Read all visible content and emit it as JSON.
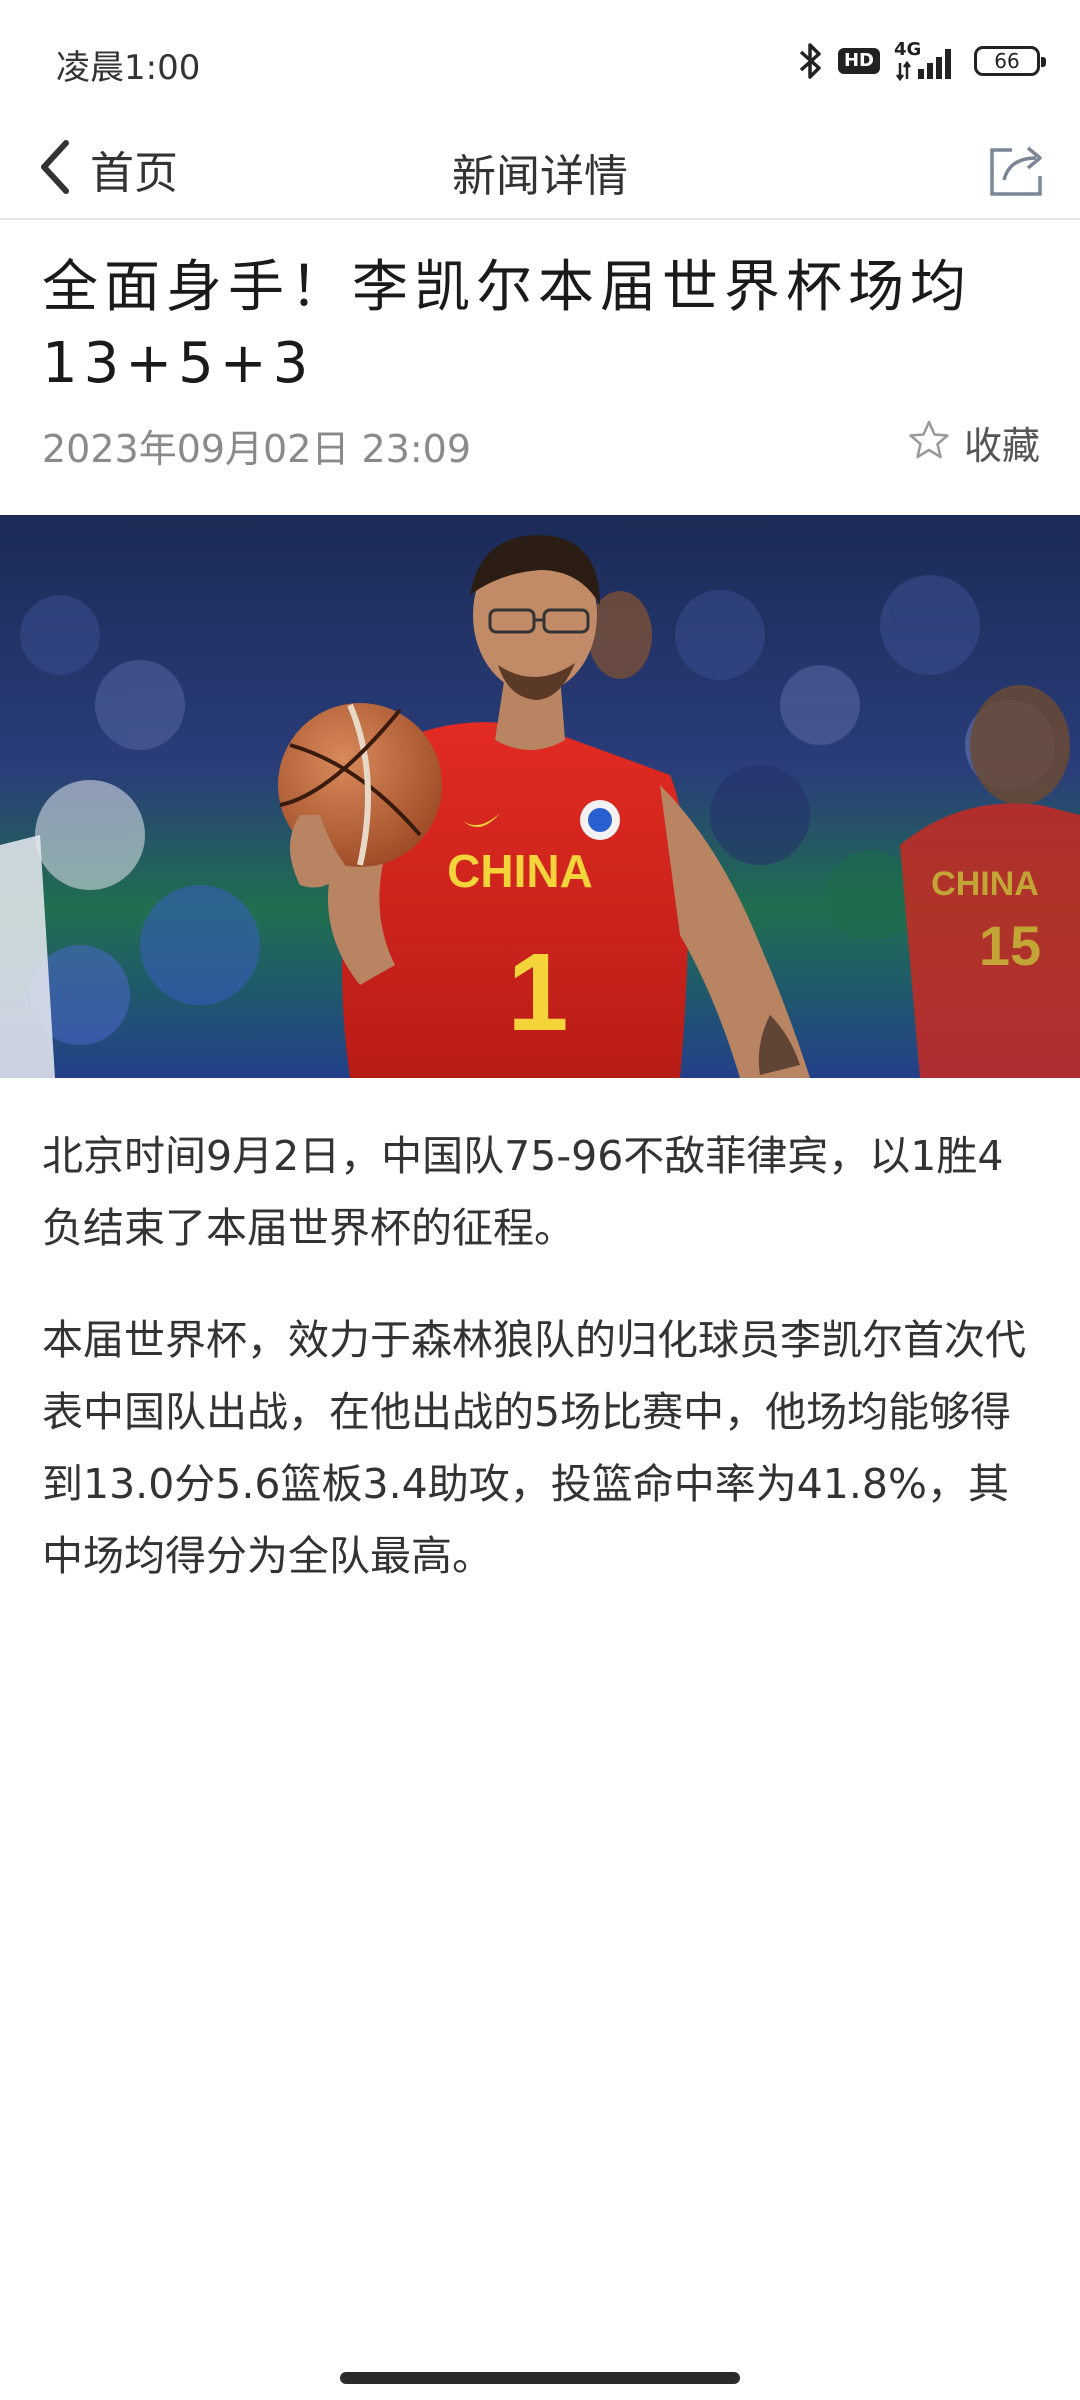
{
  "status_bar": {
    "time": "凌晨1:00",
    "hd": "HD",
    "network": "4G",
    "battery": "66"
  },
  "nav": {
    "back_label": "首页",
    "title": "新闻详情"
  },
  "article": {
    "title": "全面身手！李凯尔本届世界杯场均13+5+3",
    "date": "2023年09月02日 23:09",
    "favorite_label": "收藏",
    "image_text": {
      "jersey_team": "CHINA",
      "jersey_number": "1",
      "background_jersey_team": "CHINA",
      "background_jersey_number": "15"
    },
    "paragraphs": [
      "北京时间9月2日，中国队75-96不敌菲律宾，以1胜4负结束了本届世界杯的征程。",
      "本届世界杯，效力于森林狼队的归化球员李凯尔首次代表中国队出战，在他出战的5场比赛中，他场均能够得到13.0分5.6篮板3.4助攻，投篮命中率为41.8%，其中场均得分为全队最高。"
    ]
  },
  "colors": {
    "jersey_red": "#d8261f",
    "jersey_gold": "#f4d33b",
    "court_green": "#1f7a4f"
  }
}
